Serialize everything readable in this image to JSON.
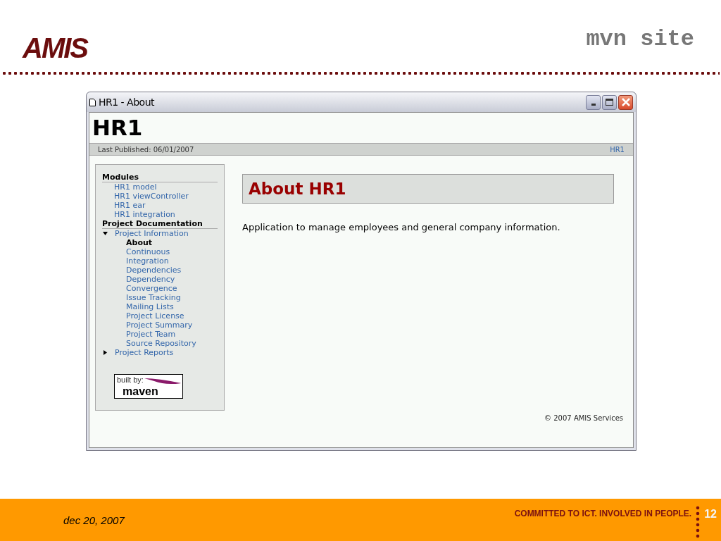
{
  "slide": {
    "logo": "AMIS",
    "title": "mvn site"
  },
  "window": {
    "title": "HR1 - About",
    "site_title": "HR1",
    "published": "Last Published: 06/01/2007",
    "breadcrumb_link": "HR1",
    "sidebar": {
      "sections": [
        {
          "title": "Modules",
          "items": [
            {
              "label": "HR1 model",
              "selected": false
            },
            {
              "label": "HR1 viewController",
              "selected": false
            },
            {
              "label": "HR1 ear",
              "selected": false
            },
            {
              "label": "HR1 integration",
              "selected": false
            }
          ]
        },
        {
          "title": "Project Documentation",
          "items": [
            {
              "label": "Project Information",
              "selected": false,
              "expanded": true,
              "children": [
                {
                  "label": "About",
                  "selected": true
                },
                {
                  "label": "Continuous Integration",
                  "selected": false
                },
                {
                  "label": "Dependencies",
                  "selected": false
                },
                {
                  "label": "Dependency Convergence",
                  "selected": false
                },
                {
                  "label": "Issue Tracking",
                  "selected": false
                },
                {
                  "label": "Mailing Lists",
                  "selected": false
                },
                {
                  "label": "Project License",
                  "selected": false
                },
                {
                  "label": "Project Summary",
                  "selected": false
                },
                {
                  "label": "Project Team",
                  "selected": false
                },
                {
                  "label": "Source Repository",
                  "selected": false
                }
              ]
            },
            {
              "label": "Project Reports",
              "selected": false,
              "expanded": false
            }
          ]
        }
      ],
      "badge": {
        "caption": "built by:",
        "name": "maven"
      }
    },
    "heading": "About HR1",
    "body": "Application to manage employees and general company information.",
    "copyright": "© 2007 AMIS Services"
  },
  "footer": {
    "date": "dec 20, 2007",
    "slogan": "COMMITTED TO ICT. INVOLVED IN PEOPLE.",
    "page": "12"
  }
}
